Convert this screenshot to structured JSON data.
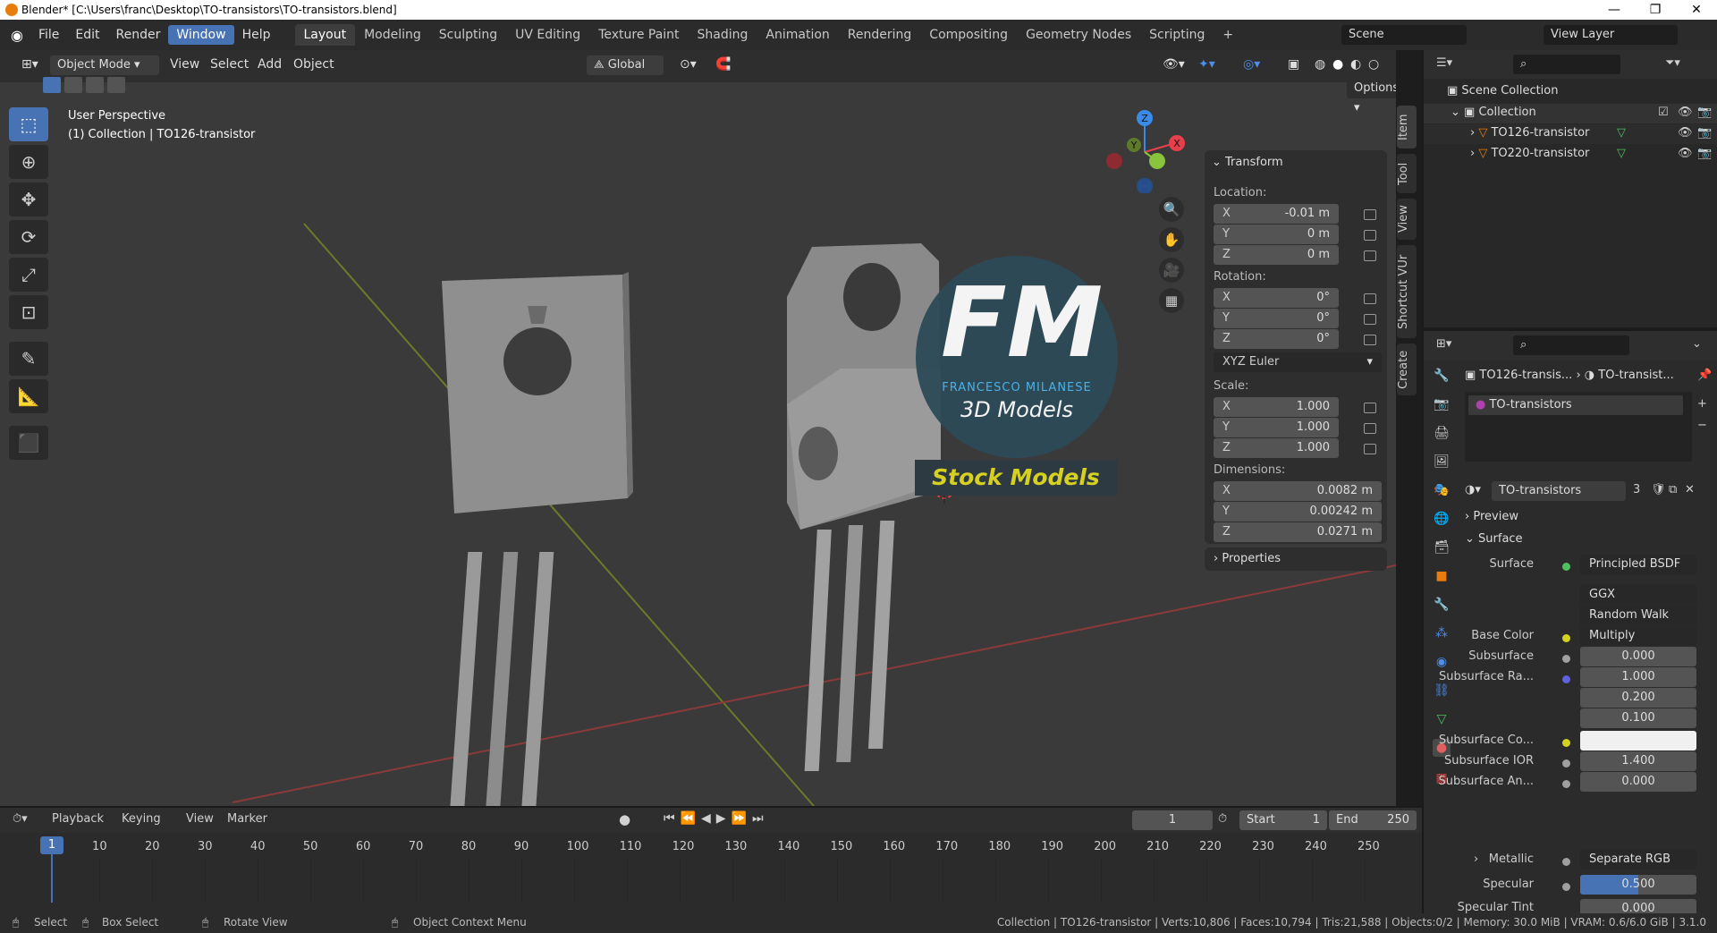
{
  "titlebar": {
    "title": "Blender* [C:\\Users\\franc\\Desktop\\TO-transistors\\TO-transistors.blend]",
    "min": "—",
    "restore": "❐",
    "close": "✕"
  },
  "menu": [
    "File",
    "Edit",
    "Render",
    "Window",
    "Help"
  ],
  "workspaces": [
    "Layout",
    "Modeling",
    "Sculpting",
    "UV Editing",
    "Texture Paint",
    "Shading",
    "Animation",
    "Rendering",
    "Compositing",
    "Geometry Nodes",
    "Scripting",
    "+"
  ],
  "scene": {
    "scene_name": "Scene",
    "view_layer": "View Layer"
  },
  "viewport_header": {
    "mode": "Object Mode",
    "view": "View",
    "select": "Select",
    "add": "Add",
    "object": "Object",
    "orientation": "Global",
    "options": "Options"
  },
  "viewport": {
    "perspective": "User Perspective",
    "collection_info": "(1) Collection | TO126-transistor"
  },
  "watermark": {
    "big": "FM",
    "name": "FRANCESCO MILANESE",
    "sub": "3D Models",
    "stock": "Stock Models"
  },
  "gizmo": {
    "x": "X",
    "y": "Y",
    "z": "Z"
  },
  "transform": {
    "title": "Transform",
    "location_label": "Location:",
    "location": {
      "x": "-0.01 m",
      "y": "0 m",
      "z": "0 m"
    },
    "rotation_label": "Rotation:",
    "rotation": {
      "x": "0°",
      "y": "0°",
      "z": "0°"
    },
    "rotation_mode": "XYZ Euler",
    "scale_label": "Scale:",
    "scale": {
      "x": "1.000",
      "y": "1.000",
      "z": "1.000"
    },
    "dimensions_label": "Dimensions:",
    "dimensions": {
      "x": "0.0082 m",
      "y": "0.00242 m",
      "z": "0.0271 m"
    },
    "properties": "Properties"
  },
  "axis": {
    "x": "X",
    "y": "Y",
    "z": "Z"
  },
  "sidetabs": [
    "Item",
    "Tool",
    "View",
    "Shortcut VUr",
    "Create"
  ],
  "outliner": {
    "scene_collection": "Scene Collection",
    "collection": "Collection",
    "items": [
      "TO126-transistor",
      "TO220-transistor"
    ]
  },
  "properties": {
    "breadcrumb_object": "TO126-transis...",
    "breadcrumb_material": "TO-transist...",
    "material_slot": "TO-transistors",
    "material_name": "TO-transistors",
    "users": "3",
    "preview": "Preview",
    "surface_section": "Surface",
    "surface_label": "Surface",
    "surface_value": "Principled BSDF",
    "distribution": "GGX",
    "subsurface_method": "Random Walk",
    "base_color_label": "Base Color",
    "base_color_value": "Multiply",
    "subsurface_label": "Subsurface",
    "subsurface_value": "0.000",
    "subsurface_radius_label": "Subsurface Ra...",
    "subsurface_radius": [
      "1.000",
      "0.200",
      "0.100"
    ],
    "subsurface_color_label": "Subsurface Co...",
    "subsurface_ior_label": "Subsurface IOR",
    "subsurface_ior_value": "1.400",
    "subsurface_aniso_label": "Subsurface An...",
    "subsurface_aniso_value": "0.000",
    "metallic_label": "Metallic",
    "metallic_value": "Separate RGB",
    "specular_label": "Specular",
    "specular_value": "0.500",
    "specular_fill": 0.5,
    "specular_tint_label": "Specular Tint",
    "specular_tint_value": "0.000"
  },
  "timeline": {
    "playback": "Playback",
    "keying": "Keying",
    "view": "View",
    "marker": "Marker",
    "current_frame": "1",
    "start_label": "Start",
    "start": "1",
    "end_label": "End",
    "end": "250",
    "ticks": [
      "1",
      "10",
      "20",
      "30",
      "40",
      "50",
      "60",
      "70",
      "80",
      "90",
      "100",
      "110",
      "120",
      "130",
      "140",
      "150",
      "160",
      "170",
      "180",
      "190",
      "200",
      "210",
      "220",
      "230",
      "240",
      "250"
    ]
  },
  "statusbar": {
    "select": "Select",
    "box_select": "Box Select",
    "rotate_view": "Rotate View",
    "context_menu": "Object Context Menu",
    "stats": "Collection | TO126-transistor | Verts:10,806 | Faces:10,794 | Tris:21,588 | Objects:0/2 | Memory: 30.0 MiB | VRAM: 0.6/6.0 GiB | 3.1.0"
  },
  "colors": {
    "accent": "#4772b3",
    "x_axis": "#e8404a",
    "y_axis": "#8ac33c",
    "z_axis": "#3a8ae8"
  }
}
